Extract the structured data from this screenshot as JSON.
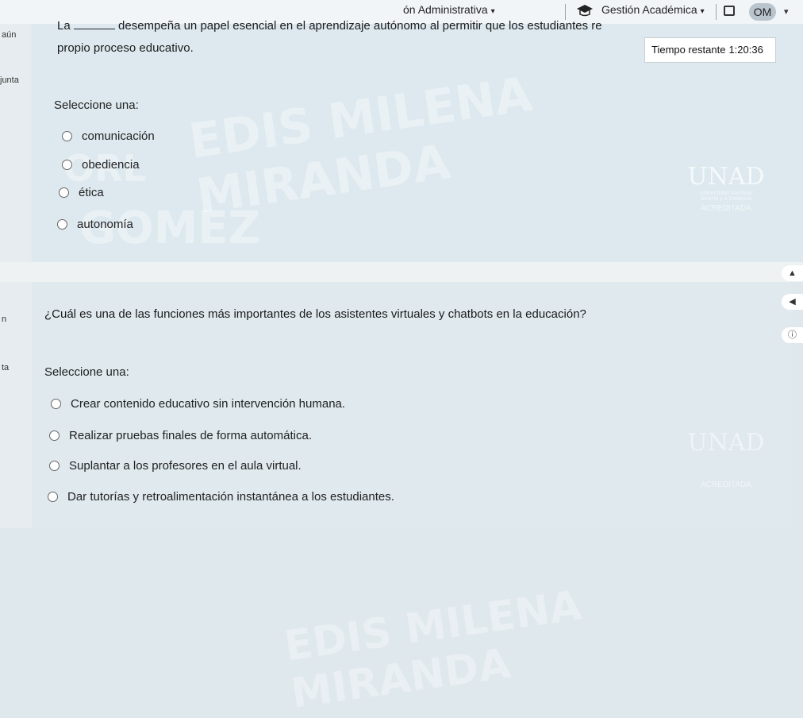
{
  "topbar": {
    "menu_admin": "ón Administrativa",
    "menu_gestion": "Gestión Académica",
    "avatar_initials": "OM"
  },
  "left_strip": {
    "text1": "aún",
    "text2": "junta",
    "text3": "n",
    "text4": "ta"
  },
  "question1": {
    "prefix": "La",
    "text_after_blank": "desempeña un papel esencial en el aprendizaje autónomo al permitir que los estudiantes re",
    "line2": "propio proceso educativo.",
    "select_label": "Seleccione una:",
    "options": [
      "comunicación",
      "obediencia",
      "ética",
      "autonomía"
    ]
  },
  "timer": {
    "label": "Tiempo restante",
    "value": "1:20:36"
  },
  "question2": {
    "text": "¿Cuál es una de las funciones más importantes de los asistentes virtuales y chatbots en la educación?",
    "select_label": "Seleccione una:",
    "options": [
      "Crear contenido educativo sin intervención humana.",
      "Realizar pruebas finales de forma automática.",
      "Suplantar a los profesores en el aula virtual.",
      "Dar tutorías y retroalimentación instantánea a los estudiantes."
    ]
  },
  "watermark": {
    "line1": "EDIS MILENA MIRANDA",
    "line2": "ORL",
    "line3": "GOMEZ",
    "line4": "EDIS MILENA MIRANDA"
  },
  "logo": {
    "name": "UNAD",
    "sub1": "Universidad Nacional",
    "sub2": "Abierta y a Distancia",
    "accred": "ACREDITADA"
  }
}
